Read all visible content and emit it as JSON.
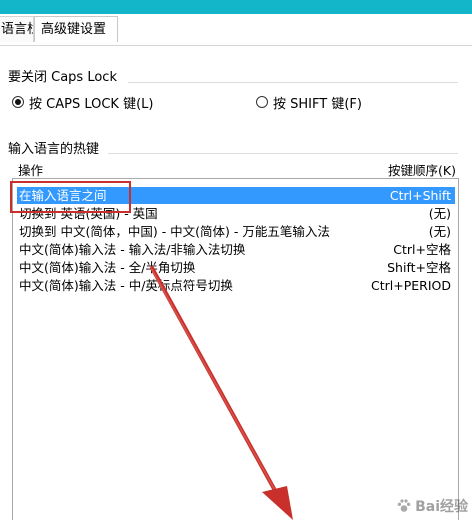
{
  "tabs": [
    {
      "label": "语言栏",
      "active": false
    },
    {
      "label": "高级键设置",
      "active": true
    }
  ],
  "caps_lock": {
    "title": "要关闭 Caps Lock",
    "options": [
      {
        "label": "按 CAPS LOCK 键(L)",
        "checked": true
      },
      {
        "label": "按 SHIFT 键(F)",
        "checked": false
      }
    ]
  },
  "hotkeys": {
    "title": "输入语言的热键",
    "col_action": "操作",
    "col_sequence": "按键顺序(K)",
    "rows": [
      {
        "action": "在输入语言之间",
        "sequence": "Ctrl+Shift",
        "selected": true
      },
      {
        "action": "切换到 英语(英国) - 英国",
        "sequence": "(无)",
        "selected": false
      },
      {
        "action": "切换到 中文(简体，中国) - 中文(简体) - 万能五笔输入法",
        "sequence": "(无)",
        "selected": false
      },
      {
        "action": "中文(简体)输入法 - 输入法/非输入法切换",
        "sequence": "Ctrl+空格",
        "selected": false
      },
      {
        "action": "中文(简体)输入法 - 全/半角切换",
        "sequence": "Shift+空格",
        "selected": false
      },
      {
        "action": "中文(简体)输入法 - 中/英标点符号切换",
        "sequence": "Ctrl+PERIOD",
        "selected": false
      }
    ]
  },
  "colors": {
    "title_bar": "#13b6c8",
    "selection": "#3399ff",
    "annotation": "#c9302c"
  },
  "watermark": {
    "text": "Bai经验",
    "icon": "paw-icon"
  }
}
